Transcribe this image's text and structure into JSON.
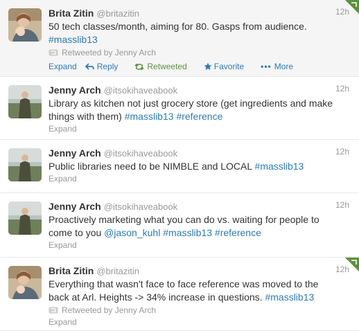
{
  "tweets": [
    {
      "name": "Brita Zitin",
      "handle": "@britazitin",
      "time": "12h",
      "text_1": "50 tech classes/month, aiming for 80. Gasps from audience.",
      "text_2": "#masslib13",
      "retweeted_by": "Retweeted by Jenny Arch",
      "actions": {
        "expand": "Expand",
        "reply": "Reply",
        "retweeted": "Retweeted",
        "favorite": "Favorite",
        "more": "More"
      },
      "reply_icon": "reply-arrow-icon",
      "retweet_icon": "retweet-icon",
      "favorite_icon": "star-icon",
      "more_icon": "ellipsis-icon"
    },
    {
      "name": "Jenny Arch",
      "handle": "@itsokihaveabook",
      "time": "12h",
      "text_1": "Library as kitchen not just grocery store (get ingredients and make things with them)",
      "text_2": "#masslib13",
      "text_3": "#reference",
      "expand": "Expand"
    },
    {
      "name": "Jenny Arch",
      "handle": "@itsokihaveabook",
      "time": "12h",
      "text_1": "Public libraries need to be NIMBLE and LOCAL",
      "text_2": "#masslib13",
      "expand": "Expand"
    },
    {
      "name": "Jenny Arch",
      "handle": "@itsokihaveabook",
      "time": "12h",
      "text_1": "Proactively marketing what you can do vs. waiting for people to come to you",
      "text_2": "@jason_kuhl",
      "text_3": "#masslib13",
      "text_4": "#reference",
      "expand": "Expand"
    },
    {
      "name": "Brita Zitin",
      "handle": "@britazitin",
      "time": "12h",
      "text_1": "Everything that wasn't face to face reference was moved to the back at Arl. Heights -> 34% increase in questions.",
      "text_2": "#masslib13",
      "retweeted_by": "Retweeted by Jenny Arch",
      "expand": "Expand"
    }
  ],
  "colors": {
    "link": "#2b7bb9",
    "retweet_green": "#5c913b",
    "muted": "#999999"
  }
}
